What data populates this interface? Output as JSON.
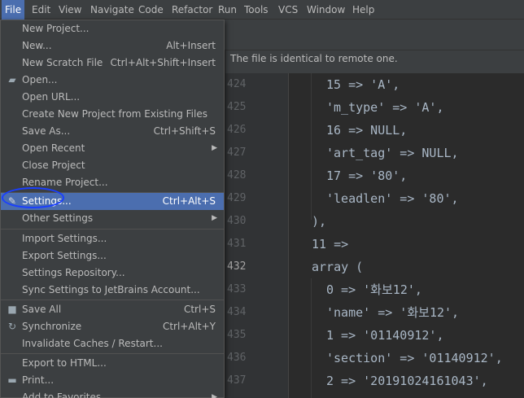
{
  "menubar": {
    "items": [
      "File",
      "Edit",
      "View",
      "Navigate",
      "Code",
      "Refactor",
      "Run",
      "Tools",
      "VCS",
      "Window",
      "Help"
    ]
  },
  "banner": {
    "text": "The file is identical to remote one."
  },
  "file_menu": {
    "items": [
      {
        "label": "New Project...",
        "shortcut": ""
      },
      {
        "label": "New...",
        "shortcut": "Alt+Insert"
      },
      {
        "label": "New Scratch File",
        "shortcut": "Ctrl+Alt+Shift+Insert"
      },
      {
        "label": "Open...",
        "shortcut": ""
      },
      {
        "label": "Open URL...",
        "shortcut": ""
      },
      {
        "label": "Create New Project from Existing Files",
        "shortcut": ""
      },
      {
        "label": "Save As...",
        "shortcut": "Ctrl+Shift+S"
      },
      {
        "label": "Open Recent",
        "shortcut": ""
      },
      {
        "label": "Close Project",
        "shortcut": ""
      },
      {
        "label": "Rename Project...",
        "shortcut": ""
      },
      {
        "label": "Settings...",
        "shortcut": "Ctrl+Alt+S"
      },
      {
        "label": "Other Settings",
        "shortcut": ""
      },
      {
        "label": "Import Settings...",
        "shortcut": ""
      },
      {
        "label": "Export Settings...",
        "shortcut": ""
      },
      {
        "label": "Settings Repository...",
        "shortcut": ""
      },
      {
        "label": "Sync Settings to JetBrains Account...",
        "shortcut": ""
      },
      {
        "label": "Save All",
        "shortcut": "Ctrl+S"
      },
      {
        "label": "Synchronize",
        "shortcut": "Ctrl+Alt+Y"
      },
      {
        "label": "Invalidate Caches / Restart...",
        "shortcut": ""
      },
      {
        "label": "Export to HTML...",
        "shortcut": ""
      },
      {
        "label": "Print...",
        "shortcut": ""
      },
      {
        "label": "Add to Favorites",
        "shortcut": ""
      }
    ]
  },
  "editor": {
    "lines": [
      {
        "num": "424",
        "code": "15 => 'A',"
      },
      {
        "num": "425",
        "code": "'m_type' => 'A',"
      },
      {
        "num": "426",
        "code": "16 => NULL,"
      },
      {
        "num": "427",
        "code": "'art_tag' => NULL,"
      },
      {
        "num": "428",
        "code": "17 => '80',"
      },
      {
        "num": "429",
        "code": "'leadlen' => '80',"
      },
      {
        "num": "430",
        "code": "),"
      },
      {
        "num": "431",
        "code": "11 =>"
      },
      {
        "num": "432",
        "code": "array ("
      },
      {
        "num": "433",
        "code": "0 => '화보12',"
      },
      {
        "num": "434",
        "code": "'name' => '화보12',"
      },
      {
        "num": "435",
        "code": "1 => '01140912',"
      },
      {
        "num": "436",
        "code": "'section' => '01140912',"
      },
      {
        "num": "437",
        "code": "2 => '20191024161043',"
      }
    ]
  },
  "colors": {
    "menu_bg": "#3c3f41",
    "selection": "#4b6eaf",
    "editor_bg": "#2b2b2b",
    "annotation": "#1a3fff"
  }
}
